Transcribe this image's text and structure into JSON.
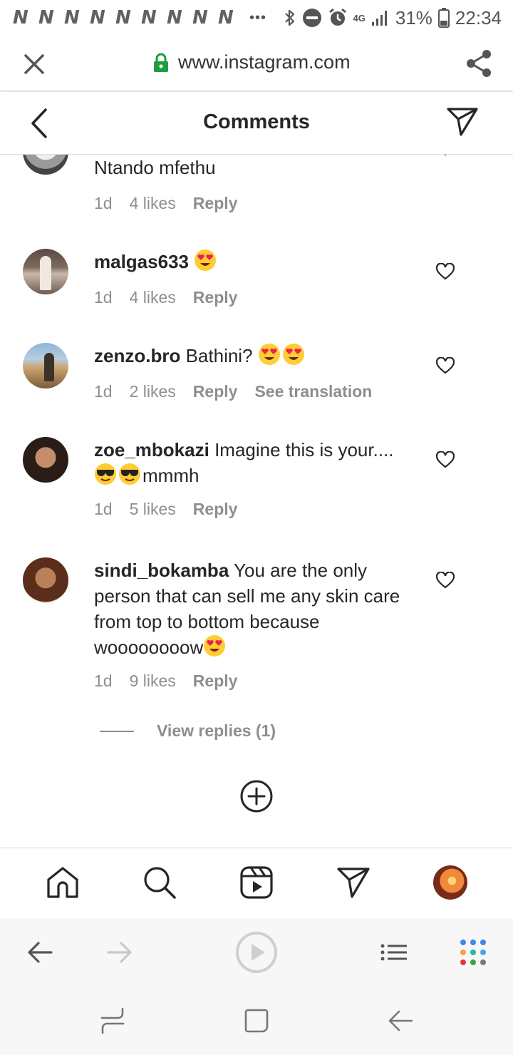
{
  "status_bar": {
    "notification_icons": [
      "N",
      "N",
      "N",
      "N",
      "N",
      "N",
      "N",
      "N",
      "N"
    ],
    "overflow": "•••",
    "network": "4G",
    "battery": "31%",
    "time": "22:34"
  },
  "browser": {
    "url": "www.instagram.com"
  },
  "header": {
    "title": "Comments"
  },
  "comments": [
    {
      "username": "",
      "text": "Ntando mfethu",
      "time": "1d",
      "likes": "4 likes",
      "reply": "Reply"
    },
    {
      "username": "malgas633",
      "text": "",
      "emojis": [
        "heart-eyes"
      ],
      "time": "1d",
      "likes": "4 likes",
      "reply": "Reply"
    },
    {
      "username": "zenzo.bro",
      "text": "Bathini?",
      "emojis": [
        "heart-eyes",
        "heart-eyes"
      ],
      "time": "1d",
      "likes": "2 likes",
      "reply": "Reply",
      "translation": "See translation"
    },
    {
      "username": "zoe_mbokazi",
      "text": "Imagine this is your....",
      "text2": "mmmh",
      "emojis": [
        "sunglasses",
        "sunglasses"
      ],
      "time": "1d",
      "likes": "5 likes",
      "reply": "Reply"
    },
    {
      "username": "sindi_bokamba",
      "text": "You are the only person that can sell me any skin care from top to bottom because woooooooow",
      "emojis": [
        "heart-eyes"
      ],
      "time": "1d",
      "likes": "9 likes",
      "reply": "Reply",
      "view_replies": "View replies (1)"
    }
  ],
  "colors": {
    "text": "#262626",
    "secondary": "#8e8e8e",
    "lock": "#1e9e3f",
    "divider": "#dbdbdb"
  }
}
